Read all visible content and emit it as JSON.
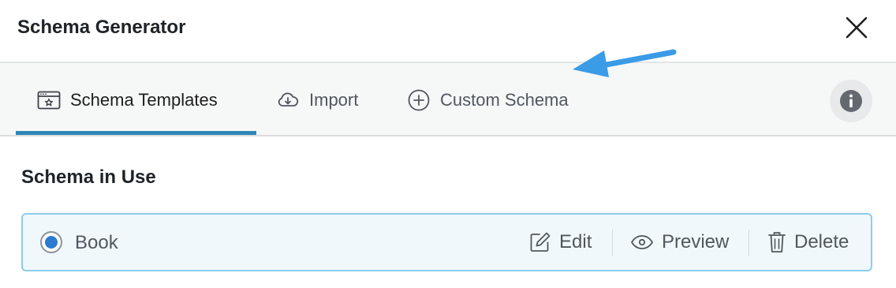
{
  "dialog": {
    "title": "Schema Generator"
  },
  "tabs": [
    {
      "label": "Schema Templates",
      "icon": "template-window-icon",
      "active": true
    },
    {
      "label": "Import",
      "icon": "cloud-download-icon",
      "active": false
    },
    {
      "label": "Custom Schema",
      "icon": "plus-circle-icon",
      "active": false
    }
  ],
  "section": {
    "title": "Schema in Use"
  },
  "schema_in_use": {
    "name": "Book",
    "selected": true,
    "actions": {
      "edit": "Edit",
      "preview": "Preview",
      "delete": "Delete"
    }
  },
  "colors": {
    "accent": "#2f86b6",
    "annotation_arrow": "#3a9be6",
    "row_border": "#8ccdec",
    "row_bg": "#f1f8fc",
    "radio_selected": "#2d7bd1"
  }
}
